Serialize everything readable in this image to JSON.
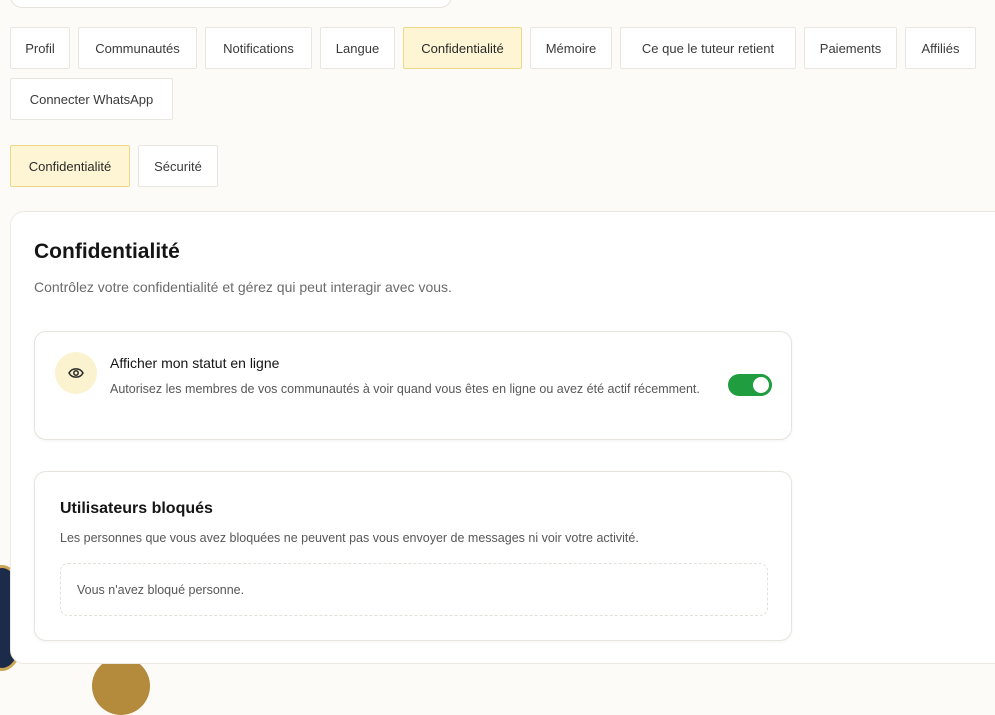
{
  "tabs": [
    {
      "label": "Profil"
    },
    {
      "label": "Communautés"
    },
    {
      "label": "Notifications"
    },
    {
      "label": "Langue"
    },
    {
      "label": "Confidentialité",
      "active": true
    },
    {
      "label": "Mémoire"
    },
    {
      "label": "Ce que le tuteur retient"
    },
    {
      "label": "Paiements"
    },
    {
      "label": "Affiliés"
    },
    {
      "label": "Connecter WhatsApp"
    }
  ],
  "subtabs": [
    {
      "label": "Confidentialité",
      "active": true
    },
    {
      "label": "Sécurité"
    }
  ],
  "section": {
    "title": "Confidentialité",
    "subtitle": "Contrôlez votre confidentialité et gérez qui peut interagir avec vous."
  },
  "online_status": {
    "icon": "eye-icon",
    "title": "Afficher mon statut en ligne",
    "description": "Autorisez les membres de vos communautés à voir quand vous êtes en ligne ou avez été actif récemment.",
    "enabled": true
  },
  "blocked_users": {
    "title": "Utilisateurs bloqués",
    "description": "Les personnes que vous avez bloquées ne peuvent pas vous envoyer de messages ni voir votre activité.",
    "empty_text": "Vous n'avez bloqué personne."
  },
  "colors": {
    "accent_bg": "#fdf5d3",
    "accent_border": "#ecd886",
    "toggle_on": "#1f9d3f"
  }
}
